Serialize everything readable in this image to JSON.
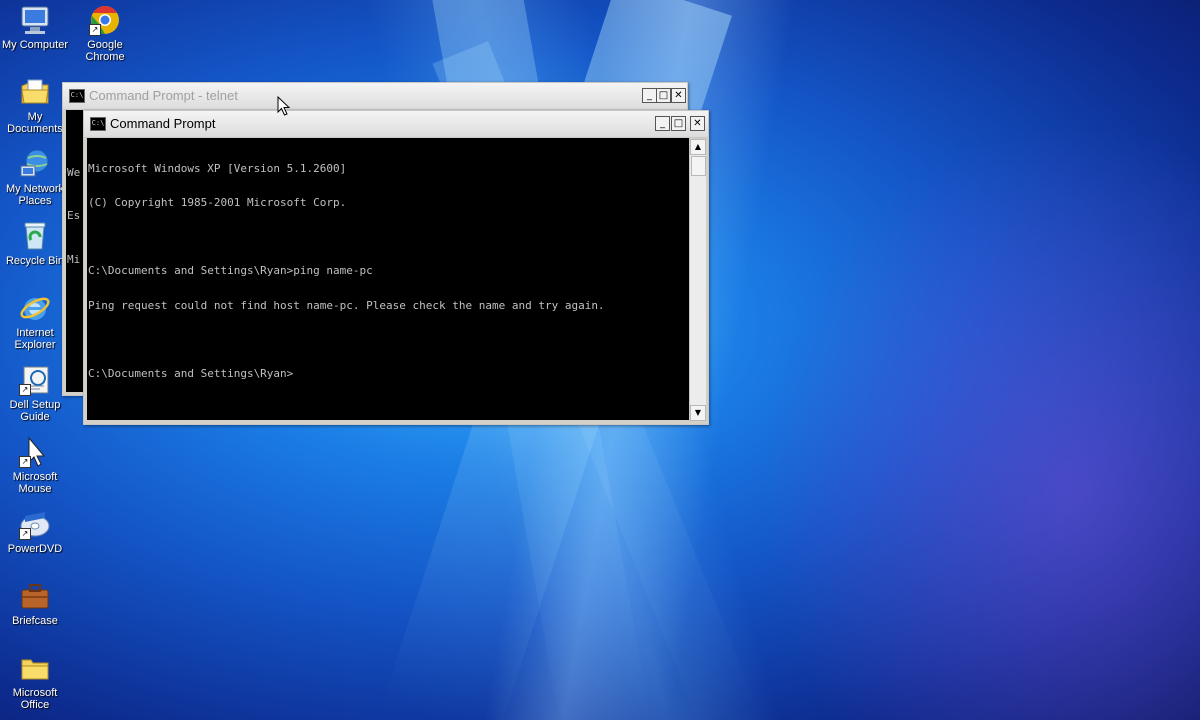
{
  "desktop": {
    "icons": [
      {
        "label": "My Computer",
        "icon": "my-computer-icon"
      },
      {
        "label": "Google Chrome",
        "icon": "chrome-icon"
      },
      {
        "label": "My Documents",
        "icon": "my-documents-icon"
      },
      {
        "label": "My Network Places",
        "icon": "network-places-icon"
      },
      {
        "label": "Recycle Bin",
        "icon": "recycle-bin-icon"
      },
      {
        "label": "Internet Explorer",
        "icon": "internet-explorer-icon"
      },
      {
        "label": "Dell Setup Guide",
        "icon": "dell-setup-guide-icon"
      },
      {
        "label": "Microsoft Mouse",
        "icon": "microsoft-mouse-icon"
      },
      {
        "label": "PowerDVD",
        "icon": "powerdvd-icon"
      },
      {
        "label": "Briefcase",
        "icon": "briefcase-icon"
      },
      {
        "label": "Microsoft Office",
        "icon": "microsoft-office-folder-icon"
      }
    ]
  },
  "windows": {
    "back": {
      "title": "Command Prompt - telnet",
      "visible_text": [
        "We",
        "Es",
        "Mi"
      ]
    },
    "front": {
      "title": "Command Prompt",
      "lines": [
        "Microsoft Windows XP [Version 5.1.2600]",
        "(C) Copyright 1985-2001 Microsoft Corp.",
        "",
        "C:\\Documents and Settings\\Ryan>ping name-pc",
        "Ping request could not find host name-pc. Please check the name and try again.",
        "",
        "C:\\Documents and Settings\\Ryan>"
      ]
    },
    "buttons": {
      "minimize": "_",
      "maximize": "□",
      "close": "✕"
    }
  },
  "colors": {
    "console_bg": "#000000",
    "console_fg": "#c0c0c0",
    "desktop_blue": "#1b7fe6"
  }
}
